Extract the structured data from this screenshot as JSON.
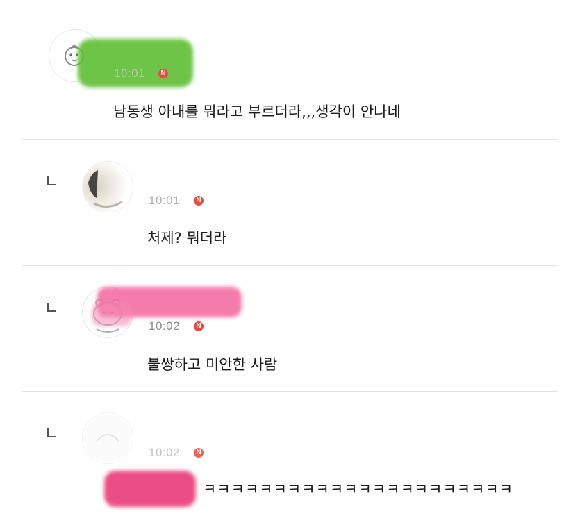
{
  "comments": [
    {
      "time": "10:01",
      "badge": "N",
      "text": "남동생 아내를 뭐라고 부르더라,,,생각이 안나네",
      "is_reply": false,
      "name_redaction_color": "#5bbd2e"
    },
    {
      "time": "10:01",
      "badge": "N",
      "text": "처제? 뭐더라",
      "is_reply": true
    },
    {
      "time": "10:02",
      "badge": "N",
      "text": "불쌍하고 미안한 사람",
      "is_reply": true,
      "name_redaction_color": "#f2609a"
    },
    {
      "time": "10:02",
      "badge": "N",
      "text": "ㅋㅋㅋㅋㅋㅋㅋㅋㅋㅋㅋㅋㅋㅋㅋㅋㅋㅋㅋㅋㅋㅋ",
      "is_reply": true,
      "mention_redaction_color": "#e8306f"
    }
  ],
  "colors": {
    "badge": "#e84a3c",
    "divider": "#e3e3e3",
    "timestamp": "#9a9a9a"
  },
  "icons": {
    "reply": "reply-corner-icon",
    "new": "new-badge-icon"
  }
}
